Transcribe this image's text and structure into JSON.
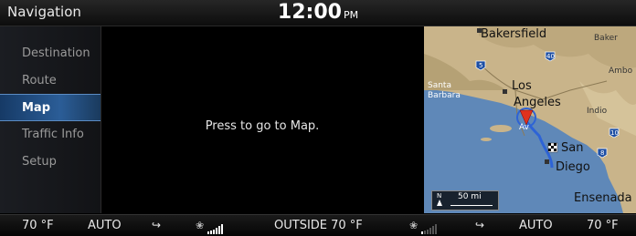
{
  "header": {
    "title": "Navigation",
    "time": "12:00",
    "ampm": "PM"
  },
  "sidebar": {
    "items": [
      {
        "label": "Destination",
        "active": false
      },
      {
        "label": "Route",
        "active": false
      },
      {
        "label": "Map",
        "active": true
      },
      {
        "label": "Traffic Info",
        "active": false
      },
      {
        "label": "Setup",
        "active": false
      }
    ]
  },
  "main": {
    "message": "Press to go to Map."
  },
  "map": {
    "cities": {
      "bakersfield": "Bakersfield",
      "baker": "Baker",
      "ambo": "Ambo",
      "santa_barbara_1": "Santa",
      "santa_barbara_2": "Barbara",
      "los": "Los",
      "angeles": "Angeles",
      "indio": "Indio",
      "avalon": "Av",
      "san": "San",
      "diego": "Diego",
      "ensenada": "Ensenada"
    },
    "highways": {
      "i5": "5",
      "i40": "40",
      "i10": "10",
      "i8": "8"
    },
    "compass": "N",
    "scale": "50 mi",
    "colors": {
      "land": "#c9b48a",
      "sea": "#5f88b8",
      "route": "#2d63d6",
      "marker": "#e0321e"
    }
  },
  "climate": {
    "left_temp": "70 °F",
    "left_mode": "AUTO",
    "outside": "OUTSIDE  70 °F",
    "right_mode": "AUTO",
    "right_temp": "70 °F",
    "left_fan_icon": "fan-icon",
    "left_fan_level": 6,
    "right_fan_level": 1
  }
}
